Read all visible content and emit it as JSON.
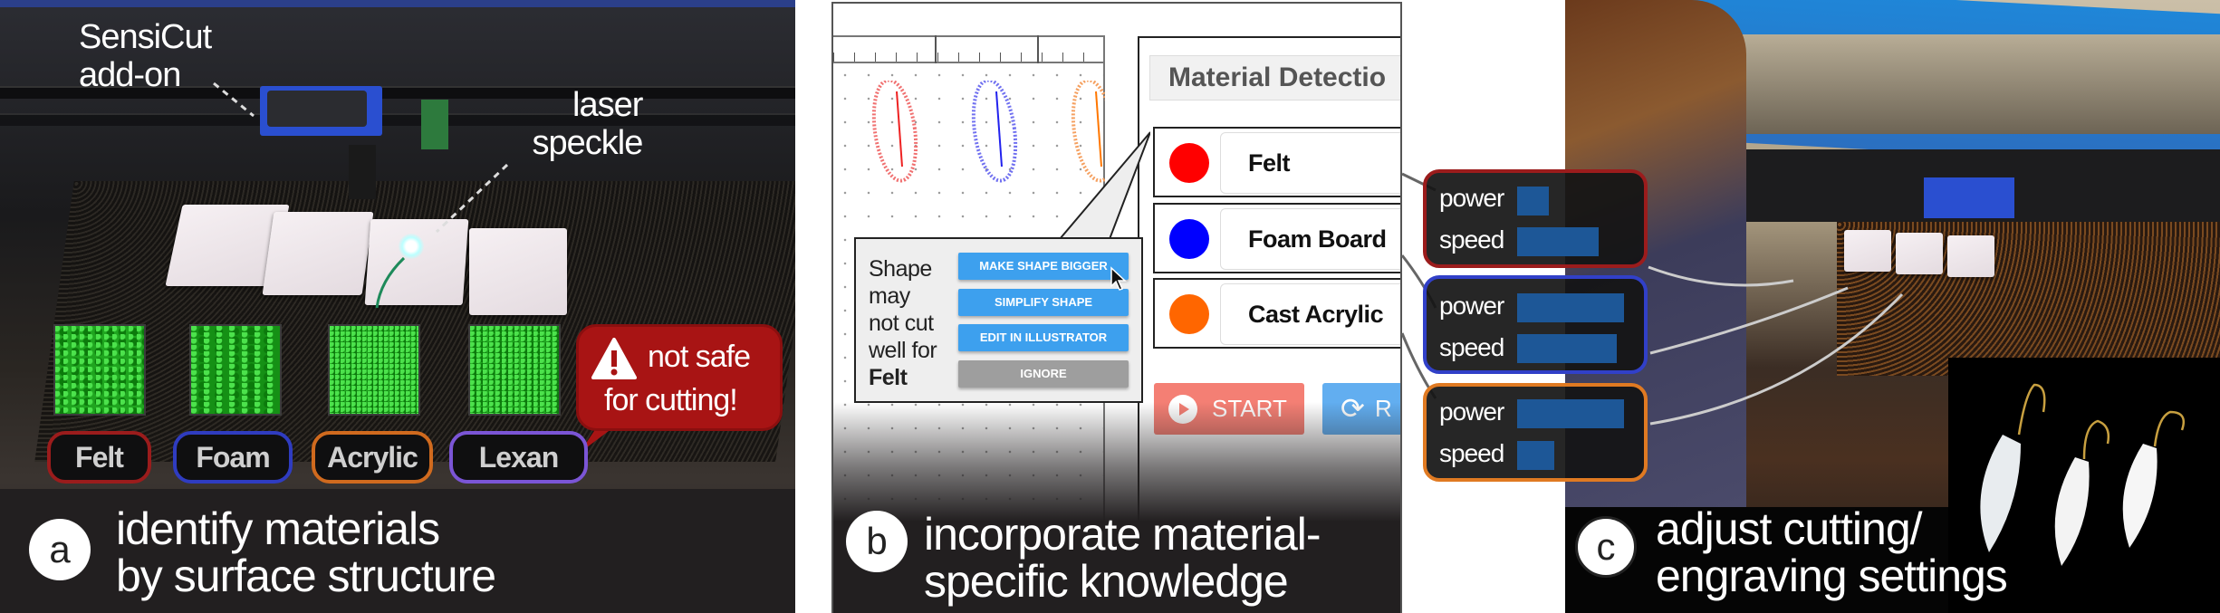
{
  "panel_a": {
    "annotations": {
      "addon": "SensiCut\nadd-on",
      "addon_l1": "SensiCut",
      "addon_l2": "add-on",
      "speckle_l1": "laser",
      "speckle_l2": "speckle"
    },
    "materials": [
      {
        "label": "Felt",
        "color": "#9b1c1c"
      },
      {
        "label": "Foam",
        "color": "#2f3cc0"
      },
      {
        "label": "Acrylic",
        "color": "#d06a1e"
      },
      {
        "label": "Lexan",
        "color": "#7b55d6"
      }
    ],
    "warning": {
      "icon": "warning-triangle-icon",
      "line1": "not safe",
      "line2": "for cutting!",
      "color": "#a81414"
    },
    "caption": {
      "letter": "a",
      "line1": "identify materials",
      "line2": "by surface structure"
    }
  },
  "panel_b": {
    "header": "Material Detectio",
    "materials": [
      {
        "label": "Felt",
        "color": "#ff0000"
      },
      {
        "label": "Foam Board",
        "color": "#0000ff"
      },
      {
        "label": "Cast Acrylic",
        "color": "#ff6600"
      }
    ],
    "popup": {
      "msg_l1": "Shape",
      "msg_l2": "may",
      "msg_l3": "not cut",
      "msg_l4": "well for",
      "material": "Felt",
      "buttons": [
        "MAKE SHAPE BIGGER",
        "SIMPLIFY SHAPE",
        "EDIT IN ILLUSTRATOR",
        "IGNORE"
      ]
    },
    "start_label": "START",
    "second_label": "R",
    "caption": {
      "letter": "b",
      "line1": "incorporate material-",
      "line2": "specific knowledge"
    }
  },
  "settings": [
    {
      "color": "#9b1c1c",
      "power_label": "power",
      "speed_label": "speed",
      "power": 0.3,
      "speed": 0.76
    },
    {
      "color": "#3140c8",
      "power_label": "power",
      "speed_label": "speed",
      "power": 1.0,
      "speed": 0.93
    },
    {
      "color": "#e07a22",
      "power_label": "power",
      "speed_label": "speed",
      "power": 1.0,
      "speed": 0.35
    }
  ],
  "panel_c": {
    "caption": {
      "letter": "c",
      "line1": "adjust cutting/",
      "line2": "engraving settings"
    }
  }
}
